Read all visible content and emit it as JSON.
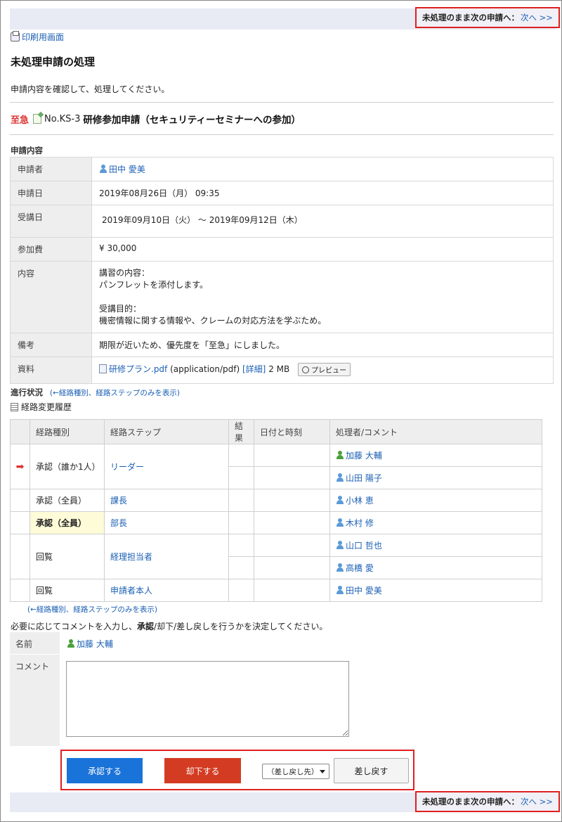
{
  "nav": {
    "next_label": "未処理のまま次の申請へ：",
    "next_link": "次へ >>"
  },
  "print_link": "印刷用画面",
  "page_title": "未処理申請の処理",
  "intro": "申請内容を確認して、処理してください。",
  "request": {
    "urgent": "至急",
    "number": "No.KS-3",
    "name": "研修参加申請（セキュリティーセミナーへの参加）"
  },
  "details": {
    "section_title": "申請内容",
    "rows": {
      "applicant_label": "申請者",
      "applicant": "田中 愛美",
      "date_label": "申請日",
      "date": "2019年08月26日（月） 09:35",
      "course_date_label": "受講日",
      "course_date": "2019年09月10日（火） 〜 2019年09月12日（木）",
      "fee_label": "参加費",
      "fee": "¥ 30,000",
      "content_label": "内容",
      "content_1": "講習の内容：",
      "content_2": "パンフレットを添付します。",
      "content_3": "受講目的：",
      "content_4": "機密情報に関する情報や、クレームの対応方法を学ぶため。",
      "note_label": "備考",
      "note": "期限が近いため、優先度を「至急」にしました。",
      "file_label": "資料",
      "file_name": "研修プラン.pdf",
      "file_type": "(application/pdf)",
      "file_detail": "[詳細]",
      "file_size": "2 MB",
      "preview": "プレビュー"
    }
  },
  "progress": {
    "title": "進行状況",
    "toggle_link": "(←経路種別、経路ステップのみを表示)",
    "toggle_link_bottom": "(←経路種別、経路ステップのみを表示)",
    "history": "経路変更履歴",
    "headers": [
      "経路種別",
      "経路ステップ",
      "結果",
      "日付と時刻",
      "処理者/コメント"
    ],
    "steps": {
      "s1_type": "承認（誰か1人）",
      "s1_step": "リーダー",
      "s1_u1": "加藤 大輔",
      "s1_u2": "山田 陽子",
      "s2_type": "承認（全員）",
      "s2_step": "課長",
      "s2_u1": "小林 恵",
      "s3_type": "承認（全員）",
      "s3_step": "部長",
      "s3_u1": "木村 修",
      "s4_type": "回覧",
      "s4_step": "経理担当者",
      "s4_u1": "山口 哲也",
      "s4_u2": "高橋 愛",
      "s5_type": "回覧",
      "s5_step": "申請者本人",
      "s5_u1": "田中 愛美"
    }
  },
  "decision": {
    "prompt_pre": "必要に応じてコメントを入力し、",
    "prompt_bold": "承認",
    "prompt_post": "/却下/差し戻しを行うかを決定してください。",
    "name_label": "名前",
    "name_value": "加藤 大輔",
    "comment_label": "コメント",
    "comment_value": ""
  },
  "actions": {
    "approve": "承認する",
    "reject": "却下する",
    "return_target": "（差し戻し先）",
    "return": "差し戻す"
  },
  "colors": {
    "approve": "#1a73d8",
    "reject": "#d33c22",
    "link": "#1a5fb4",
    "highlight_box": "#e02020"
  }
}
